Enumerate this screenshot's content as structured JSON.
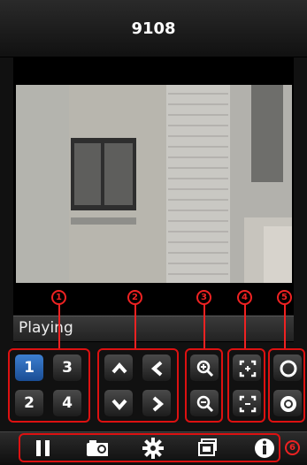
{
  "header": {
    "title": "9108"
  },
  "status": {
    "text": "Playing"
  },
  "markers": [
    "1",
    "2",
    "3",
    "4",
    "5",
    "6"
  ],
  "channels": {
    "ch1": "1",
    "ch2": "2",
    "ch3": "3",
    "ch4": "4",
    "active": "1"
  },
  "ptz": [
    "up",
    "left",
    "down",
    "right"
  ],
  "zoom": [
    "zoom-in",
    "zoom-out"
  ],
  "focus": [
    "focus-in",
    "focus-out"
  ],
  "iris": [
    "iris-open",
    "iris-close"
  ],
  "toolbar": [
    "pause",
    "snapshot",
    "settings",
    "gallery",
    "info"
  ],
  "colors": {
    "accent_red": "#dd1111",
    "active_blue": "#2f6fc0",
    "panel": "#111111"
  }
}
